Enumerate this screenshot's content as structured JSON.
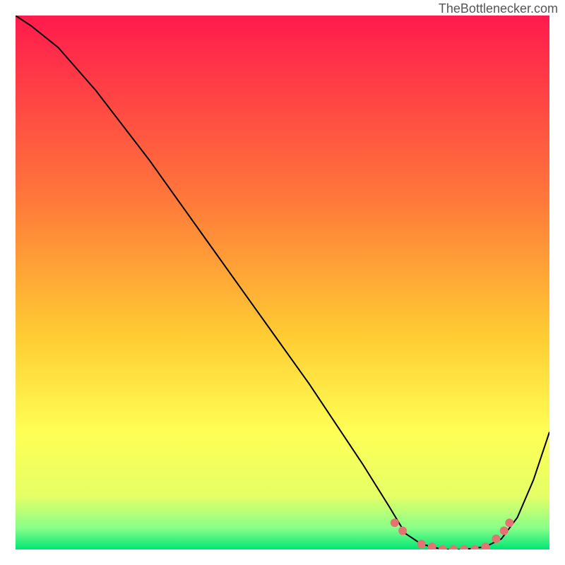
{
  "watermark": "TheBottlenecker.com",
  "chart_data": {
    "type": "line",
    "title": "",
    "xlabel": "",
    "ylabel": "",
    "xlim": [
      0,
      100
    ],
    "ylim": [
      0,
      100
    ],
    "background_gradient": {
      "stops": [
        {
          "offset": 0,
          "color": "#ff1a4d"
        },
        {
          "offset": 35,
          "color": "#ff7a3a"
        },
        {
          "offset": 60,
          "color": "#ffcc33"
        },
        {
          "offset": 78,
          "color": "#ffff55"
        },
        {
          "offset": 90,
          "color": "#e5ff66"
        },
        {
          "offset": 96,
          "color": "#88ff88"
        },
        {
          "offset": 100,
          "color": "#00e676"
        }
      ]
    },
    "series": [
      {
        "name": "curve",
        "x": [
          0,
          3,
          8,
          15,
          25,
          35,
          45,
          55,
          65,
          70,
          73,
          76,
          80,
          84,
          88,
          91,
          94,
          97,
          100
        ],
        "y": [
          100,
          98,
          94,
          86,
          73,
          59,
          45,
          31,
          16,
          8,
          3,
          1,
          0,
          0,
          0.5,
          2,
          6,
          13,
          22
        ]
      }
    ],
    "markers": {
      "name": "dots",
      "color": "#e57373",
      "x": [
        71,
        72.5,
        76,
        78,
        80,
        82,
        84,
        86,
        88,
        90,
        91.5,
        92.5
      ],
      "y": [
        5,
        3.5,
        1,
        0.5,
        0,
        0,
        0,
        0,
        0.5,
        2,
        3.5,
        5
      ]
    }
  }
}
